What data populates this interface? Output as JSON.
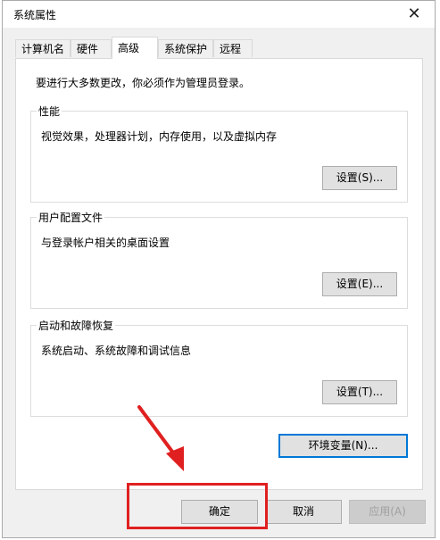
{
  "window": {
    "title": "系统属性",
    "close_glyph": "✕"
  },
  "tabs": [
    {
      "label": "计算机名"
    },
    {
      "label": "硬件"
    },
    {
      "label": "高级"
    },
    {
      "label": "系统保护"
    },
    {
      "label": "远程"
    }
  ],
  "active_tab": "高级",
  "advanced": {
    "admin_note": "要进行大多数更改，你必须作为管理员登录。",
    "performance": {
      "legend": "性能",
      "description": "视觉效果，处理器计划，内存使用，以及虚拟内存",
      "button": "设置(S)..."
    },
    "user_profiles": {
      "legend": "用户配置文件",
      "description": "与登录帐户相关的桌面设置",
      "button": "设置(E)..."
    },
    "startup_recovery": {
      "legend": "启动和故障恢复",
      "description": "系统启动、系统故障和调试信息",
      "button": "设置(T)..."
    },
    "env_button": "环境变量(N)..."
  },
  "footer": {
    "ok": "确定",
    "cancel": "取消",
    "apply": "应用(A)"
  },
  "annotation_color": "#e02020",
  "accent_color": "#0078d7"
}
